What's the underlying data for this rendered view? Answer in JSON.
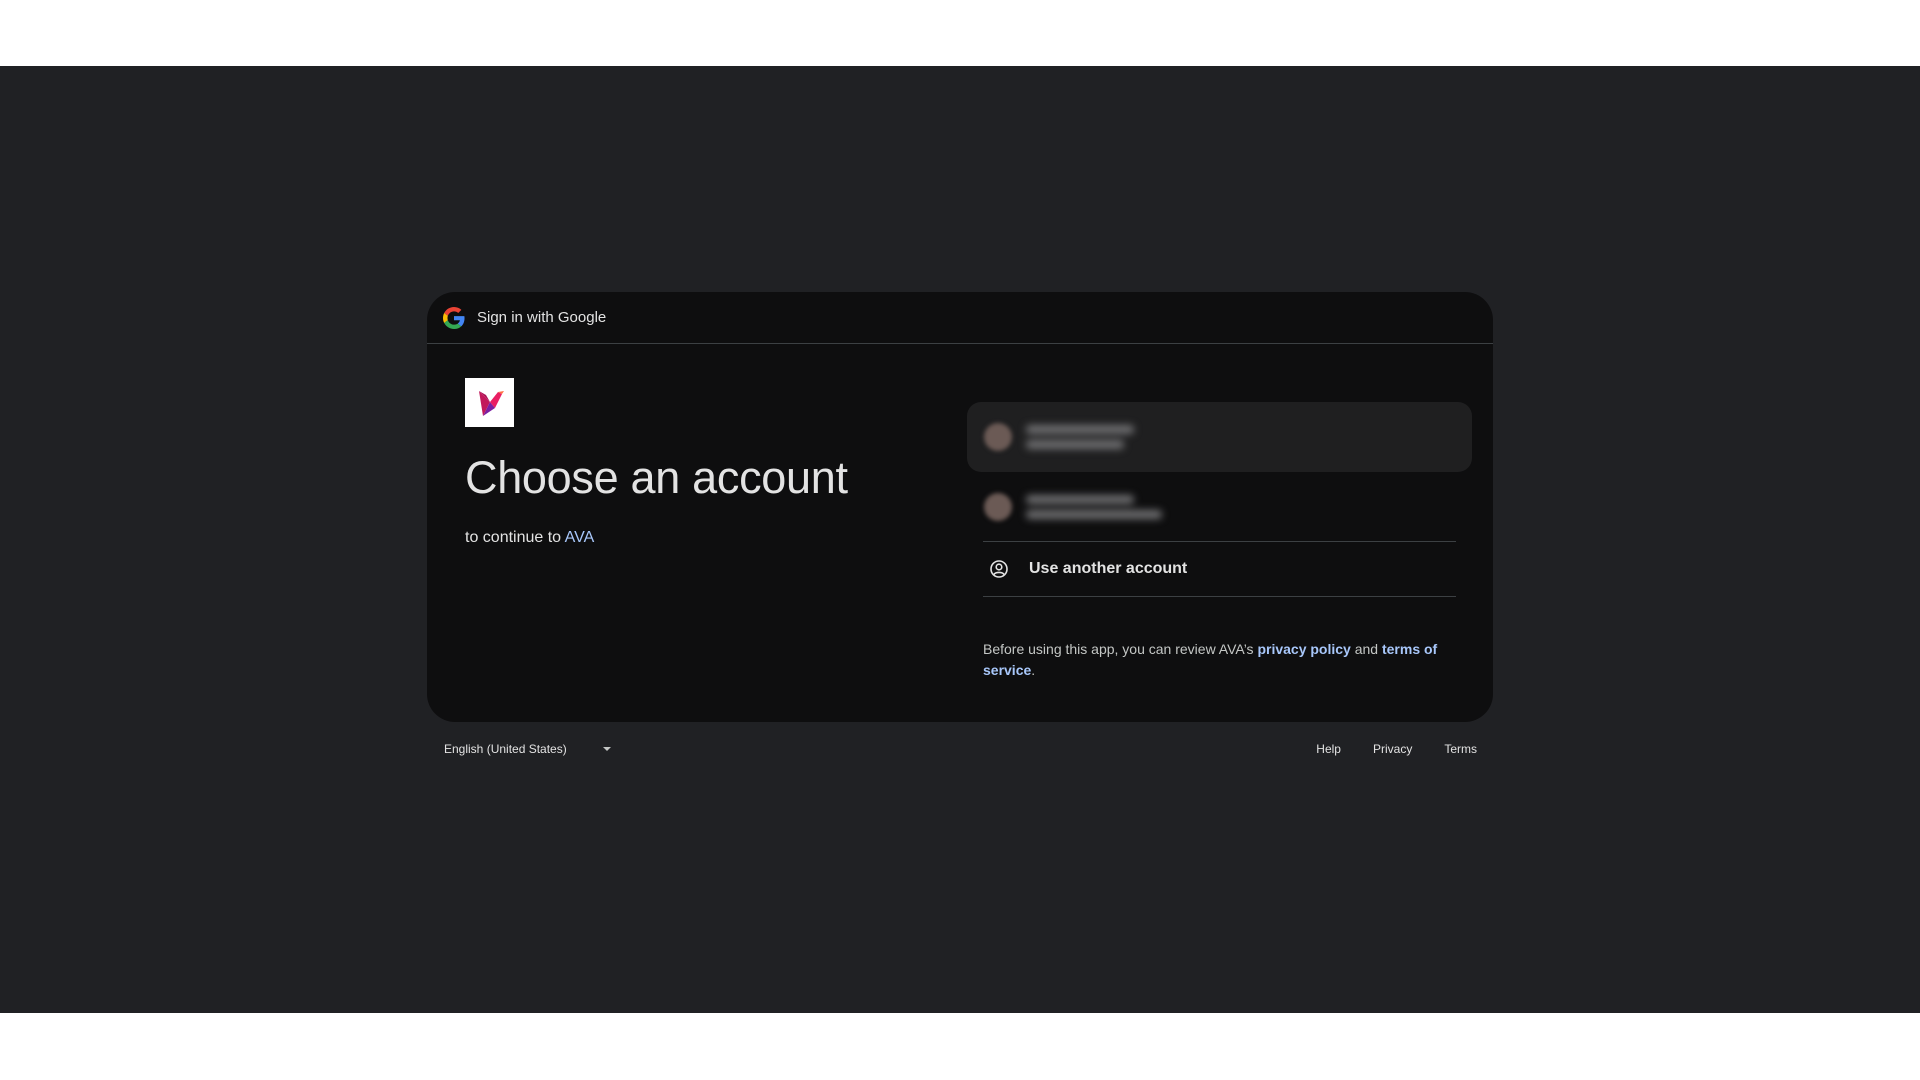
{
  "header": {
    "icon": "google-g-icon",
    "title": "Sign in with Google"
  },
  "left": {
    "logo_icon": "hummingbird-logo",
    "heading": "Choose an account",
    "subheading_prefix": "to continue to ",
    "app_name": "AVA"
  },
  "accounts": {
    "items": [
      {
        "state": "redacted-blurred"
      },
      {
        "state": "redacted-blurred"
      }
    ],
    "use_another": {
      "icon": "account-circle-icon",
      "label": "Use another account"
    }
  },
  "disclaimer": {
    "prefix": "Before using this app, you can review AVA’s ",
    "privacy_link": "privacy policy",
    "middle": " and ",
    "terms_link": "terms of service",
    "suffix": "."
  },
  "footer": {
    "language": "English (United States)",
    "links": {
      "help": "Help",
      "privacy": "Privacy",
      "terms": "Terms"
    }
  },
  "colors": {
    "page_background": "#202124",
    "card_background": "#0e0e0f",
    "link": "#a8c7fa",
    "text": "#e3e3e3"
  }
}
